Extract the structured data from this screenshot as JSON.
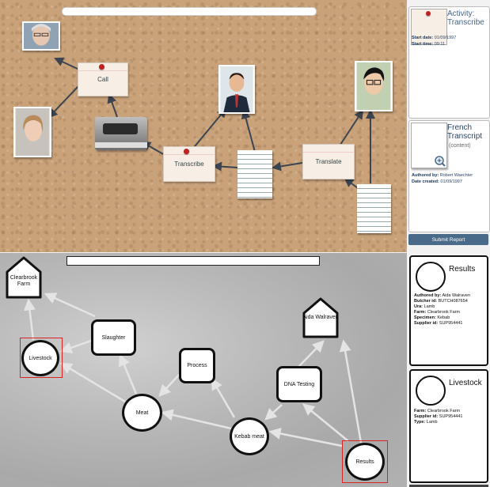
{
  "corkboard": {
    "nodes": {
      "call": "Call",
      "transcribe": "Transcribe",
      "translate": "Translate"
    }
  },
  "activity_panel": {
    "title": "Activity: Transcribe",
    "start_date_label": "Start date:",
    "start_date": "01/09/1997",
    "start_time_label": "Start time:",
    "start_time": "09:11"
  },
  "document_panel": {
    "title": "French Transcript",
    "subtitle": "(content)",
    "authored_by_label": "Authored by:",
    "authored_by": "Robert Waechter",
    "date_created_label": "Date created:",
    "date_created": "01/09/1997"
  },
  "submit_label": "Submit Report",
  "graph": {
    "nodes": {
      "clearbrook": "Clearbrook Farm",
      "aida": "Aida Walraven",
      "livestock": "Livestock",
      "slaughter": "Slaughter",
      "process": "Process",
      "dna": "DNA Testing",
      "meat": "Meat",
      "kebab": "Kebab meat",
      "results": "Results"
    }
  },
  "results_panel": {
    "title": "Results",
    "rows": [
      {
        "label": "Authored by:",
        "value": "Aida Walraven"
      },
      {
        "label": "Butcher id:",
        "value": "BUTCH087654"
      },
      {
        "label": "Ura:",
        "value": "Lamb"
      },
      {
        "label": "Farm:",
        "value": "Clearbrook Farm"
      },
      {
        "label": "Specimen:",
        "value": "Kebab"
      },
      {
        "label": "Supplier id:",
        "value": "SUP954441"
      }
    ]
  },
  "livestock_panel": {
    "title": "Livestock",
    "rows": [
      {
        "label": "Farm:",
        "value": "Clearbrook Farm"
      },
      {
        "label": "Supplier id:",
        "value": "SUP954441"
      },
      {
        "label": "Type:",
        "value": "Lamb"
      }
    ]
  },
  "colors": {
    "cork": "#c9a27a",
    "panel_accent": "#446688",
    "submit_bg": "#4a6a8a",
    "selection": "#dd2222"
  }
}
